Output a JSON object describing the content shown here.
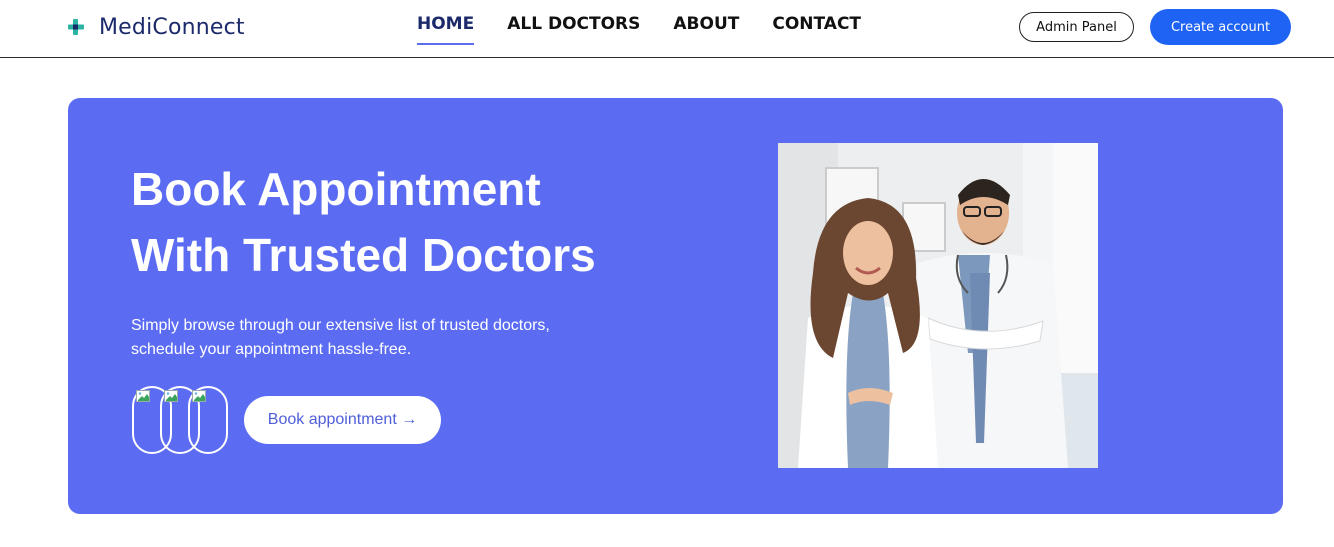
{
  "header": {
    "brand": "MediConnect",
    "nav": [
      {
        "label": "HOME",
        "active": true
      },
      {
        "label": "ALL DOCTORS",
        "active": false
      },
      {
        "label": "ABOUT",
        "active": false
      },
      {
        "label": "CONTACT",
        "active": false
      }
    ],
    "admin_label": "Admin Panel",
    "create_label": "Create account"
  },
  "hero": {
    "title_line1": "Book Appointment",
    "title_line2": "With Trusted Doctors",
    "subtitle_line1": "Simply browse through our extensive list of trusted doctors,",
    "subtitle_line2": "schedule your appointment hassle-free.",
    "book_label": "Book appointment →"
  },
  "colors": {
    "brand_text": "#1b2a6b",
    "primary_button": "#1f63f5",
    "hero_background": "#5b6cf3",
    "book_text": "#4f5fd8"
  },
  "icons": {
    "logo": "medical-cross-icon",
    "avatar": "broken-image-icon"
  }
}
